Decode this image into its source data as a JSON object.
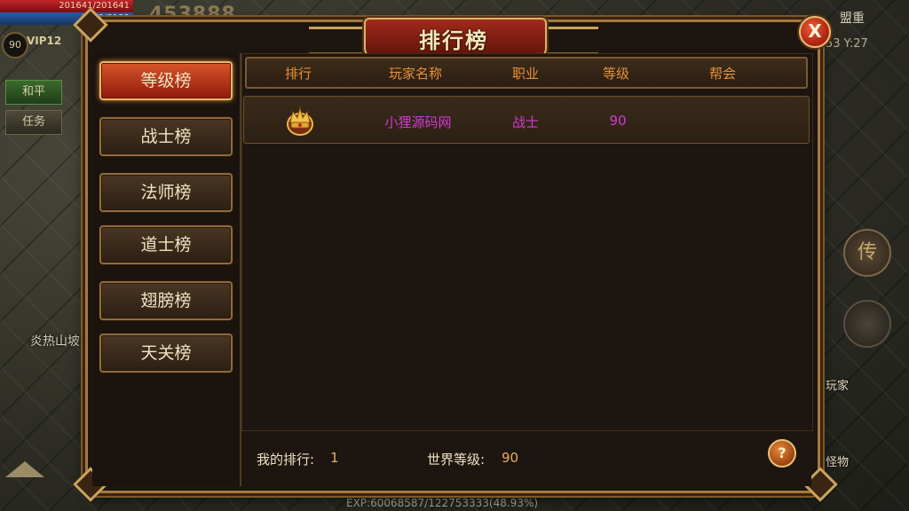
{
  "hud": {
    "hp_text": "201641/201641",
    "mp_text": "3132/3132",
    "score": "453888",
    "player_level": "90",
    "vip": "VIP12",
    "mode_button": "和平",
    "task_button": "任务",
    "place_name": "炎热山坡",
    "top_right_name": "盟重",
    "coords": "53 Y:27",
    "transfer_icon_text": "传",
    "right_label_player": "玩家",
    "right_label_monster": "怪物",
    "exp_text": "EXP:60068587/122753333(48.93%)"
  },
  "panel": {
    "title": "排行榜",
    "close_label": "X",
    "categories": [
      {
        "label": "等级榜",
        "active": true
      },
      {
        "label": "战士榜",
        "active": false
      },
      {
        "label": "法师榜",
        "active": false
      },
      {
        "label": "道士榜",
        "active": false
      },
      {
        "label": "翅膀榜",
        "active": false
      },
      {
        "label": "天关榜",
        "active": false
      }
    ],
    "columns": [
      "排行",
      "玩家名称",
      "职业",
      "等级",
      "帮会"
    ],
    "rows": [
      {
        "rank_icon": "crown-icon",
        "name": "小狸源码网",
        "job": "战士",
        "level": "90",
        "guild": ""
      }
    ],
    "footer": {
      "my_rank_label": "我的排行:",
      "my_rank_value": "1",
      "world_level_label": "世界等级:",
      "world_level_value": "90",
      "help_label": "?"
    }
  },
  "colors": {
    "accent_gold": "#c9a45c",
    "header_text": "#e6913a",
    "row_text": "#d33ad3",
    "active_tab": "#d8552a"
  }
}
